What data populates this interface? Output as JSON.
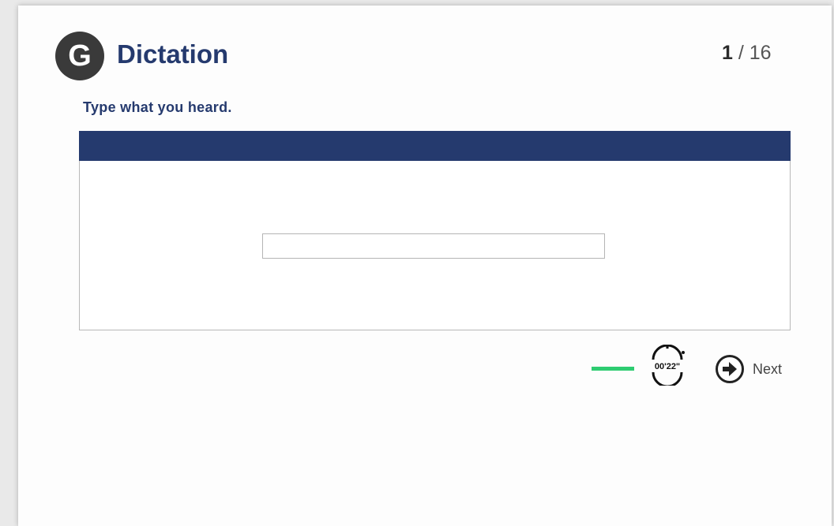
{
  "header": {
    "logo_letter": "G",
    "title": "Dictation",
    "counter_current": "1",
    "counter_separator": " / ",
    "counter_total": "16"
  },
  "question": {
    "instruction": "Type what you heard.",
    "answer_value": "",
    "answer_placeholder": ""
  },
  "footer": {
    "progress_percent": 100,
    "progress_color": "#2ecc71",
    "timer": "00'22\"",
    "next_label": "Next",
    "next_icon": "arrow-right-circle-icon",
    "timer_icon": "stopwatch-icon"
  },
  "colors": {
    "brand_navy": "#253a6e",
    "logo_bg": "#3a3a3a"
  }
}
